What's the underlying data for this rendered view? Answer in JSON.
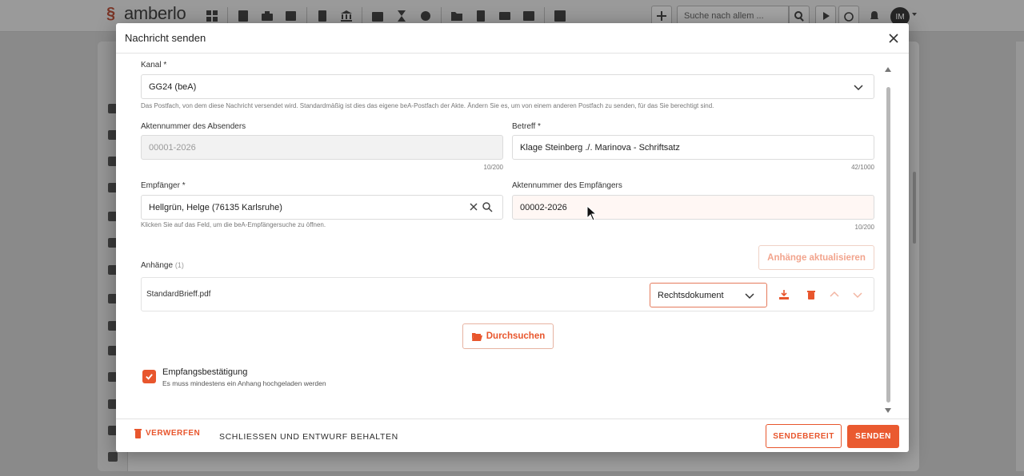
{
  "app": {
    "logo_text": "amberlo",
    "search_placeholder": "Suche nach allem ...",
    "avatar_initials": "IM"
  },
  "modal": {
    "title": "Nachricht senden",
    "kanal": {
      "label": "Kanal *",
      "value": "GG24 (beA)",
      "hint": "Das Postfach, von dem diese Nachricht versendet wird. Standardmäßig ist dies das eigene beA-Postfach der Akte. Ändern Sie es, um von einem anderen Postfach zu senden, für das Sie berechtigt sind."
    },
    "sender_ref": {
      "label": "Aktennummer des Absenders",
      "value": "00001-2026",
      "counter": "10/200"
    },
    "subject": {
      "label": "Betreff *",
      "value": "Klage Steinberg ./. Marinova - Schriftsatz",
      "counter": "42/1000"
    },
    "recipient": {
      "label": "Empfänger *",
      "value": "Hellgrün, Helge (76135 Karlsruhe)",
      "hint": "Klicken Sie auf das Feld, um die beA-Empfängersuche zu öffnen."
    },
    "recipient_ref": {
      "label": "Aktennummer des Empfängers",
      "value": "00002-2026",
      "counter": "10/200"
    },
    "attachments": {
      "label": "Anhänge",
      "count": "(1)",
      "refresh_label": "Anhänge aktualisieren",
      "items": [
        {
          "name": "StandardBrieff.pdf",
          "type": "Rechtsdokument"
        }
      ],
      "browse_label": "Durchsuchen"
    },
    "receipt": {
      "label": "Empfangsbestätigung",
      "sub": "Es muss mindestens ein Anhang hochgeladen werden",
      "checked": true
    },
    "footer": {
      "discard_label": "VERWERFEN",
      "keep_label": "SCHLIESSEN UND ENTWURF BEHALTEN",
      "ready_label": "SENDEBEREIT",
      "send_label": "SENDEN"
    }
  },
  "colors": {
    "accent": "#e8562d",
    "accent_light": "#f2a48d"
  }
}
